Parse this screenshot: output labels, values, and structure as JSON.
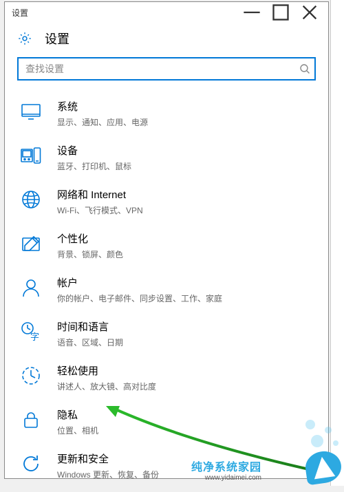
{
  "window": {
    "title": "设置"
  },
  "header": {
    "title": "设置"
  },
  "search": {
    "placeholder": "查找设置"
  },
  "items": [
    {
      "title": "系统",
      "subtitle": "显示、通知、应用、电源",
      "icon": "monitor-icon"
    },
    {
      "title": "设备",
      "subtitle": "蓝牙、打印机、鼠标",
      "icon": "devices-icon"
    },
    {
      "title": "网络和 Internet",
      "subtitle": "Wi-Fi、飞行模式、VPN",
      "icon": "globe-icon"
    },
    {
      "title": "个性化",
      "subtitle": "背景、锁屏、颜色",
      "icon": "personalize-icon"
    },
    {
      "title": "帐户",
      "subtitle": "你的帐户、电子邮件、同步设置、工作、家庭",
      "icon": "account-icon"
    },
    {
      "title": "时间和语言",
      "subtitle": "语音、区域、日期",
      "icon": "time-lang-icon"
    },
    {
      "title": "轻松使用",
      "subtitle": "讲述人、放大镜、高对比度",
      "icon": "ease-access-icon"
    },
    {
      "title": "隐私",
      "subtitle": "位置、相机",
      "icon": "privacy-icon"
    },
    {
      "title": "更新和安全",
      "subtitle": "Windows 更新、恢复、备份",
      "icon": "update-icon"
    }
  ],
  "watermark": {
    "text_cn": "纯净系统家园",
    "url": "www.yidaimei.com"
  }
}
